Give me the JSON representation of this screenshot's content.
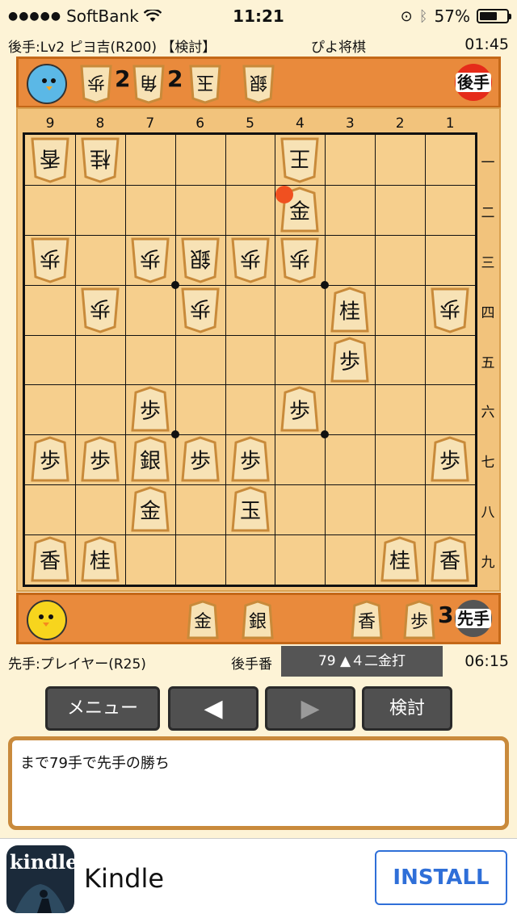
{
  "status": {
    "carrier": "SoftBank",
    "time": "11:21",
    "battery": "57%"
  },
  "gote_info": {
    "player": "後手:Lv2 ピヨ吉(R200) 【検討】",
    "app_title": "ぴよ将棋",
    "clock": "01:45"
  },
  "gote_hand": {
    "badge": "後手",
    "pieces": [
      {
        "kanji": "歩",
        "count": "2"
      },
      {
        "kanji": "角",
        "count": "2"
      },
      {
        "kanji": "玉",
        "count": ""
      },
      {
        "kanji": "銀",
        "count": ""
      }
    ]
  },
  "board": {
    "columns": [
      "9",
      "8",
      "7",
      "6",
      "5",
      "4",
      "3",
      "2",
      "1"
    ],
    "rows": [
      "一",
      "二",
      "三",
      "四",
      "五",
      "六",
      "七",
      "八",
      "九"
    ],
    "pieces": [
      {
        "file": 9,
        "rank": 1,
        "kanji": "香",
        "owner": "gote"
      },
      {
        "file": 8,
        "rank": 1,
        "kanji": "桂",
        "owner": "gote"
      },
      {
        "file": 4,
        "rank": 1,
        "kanji": "王",
        "owner": "gote"
      },
      {
        "file": 4,
        "rank": 2,
        "kanji": "金",
        "owner": "sente"
      },
      {
        "file": 9,
        "rank": 3,
        "kanji": "歩",
        "owner": "gote"
      },
      {
        "file": 7,
        "rank": 3,
        "kanji": "歩",
        "owner": "gote"
      },
      {
        "file": 6,
        "rank": 3,
        "kanji": "銀",
        "owner": "gote"
      },
      {
        "file": 5,
        "rank": 3,
        "kanji": "歩",
        "owner": "gote"
      },
      {
        "file": 4,
        "rank": 3,
        "kanji": "歩",
        "owner": "gote"
      },
      {
        "file": 8,
        "rank": 4,
        "kanji": "歩",
        "owner": "gote"
      },
      {
        "file": 6,
        "rank": 4,
        "kanji": "歩",
        "owner": "gote"
      },
      {
        "file": 3,
        "rank": 4,
        "kanji": "桂",
        "owner": "sente"
      },
      {
        "file": 1,
        "rank": 4,
        "kanji": "歩",
        "owner": "gote"
      },
      {
        "file": 3,
        "rank": 5,
        "kanji": "歩",
        "owner": "sente"
      },
      {
        "file": 7,
        "rank": 6,
        "kanji": "歩",
        "owner": "sente"
      },
      {
        "file": 4,
        "rank": 6,
        "kanji": "歩",
        "owner": "sente"
      },
      {
        "file": 9,
        "rank": 7,
        "kanji": "歩",
        "owner": "sente"
      },
      {
        "file": 8,
        "rank": 7,
        "kanji": "歩",
        "owner": "sente"
      },
      {
        "file": 7,
        "rank": 7,
        "kanji": "銀",
        "owner": "sente"
      },
      {
        "file": 6,
        "rank": 7,
        "kanji": "歩",
        "owner": "sente"
      },
      {
        "file": 5,
        "rank": 7,
        "kanji": "歩",
        "owner": "sente"
      },
      {
        "file": 1,
        "rank": 7,
        "kanji": "歩",
        "owner": "sente"
      },
      {
        "file": 7,
        "rank": 8,
        "kanji": "金",
        "owner": "sente"
      },
      {
        "file": 5,
        "rank": 8,
        "kanji": "玉",
        "owner": "sente"
      },
      {
        "file": 9,
        "rank": 9,
        "kanji": "香",
        "owner": "sente"
      },
      {
        "file": 8,
        "rank": 9,
        "kanji": "桂",
        "owner": "sente"
      },
      {
        "file": 2,
        "rank": 9,
        "kanji": "桂",
        "owner": "sente"
      },
      {
        "file": 1,
        "rank": 9,
        "kanji": "香",
        "owner": "sente"
      }
    ],
    "last_move": {
      "file": 4,
      "rank": 2
    }
  },
  "sente_hand": {
    "badge": "先手",
    "pieces": [
      {
        "kanji": "金",
        "count": ""
      },
      {
        "kanji": "銀",
        "count": ""
      },
      {
        "kanji": "香",
        "count": ""
      },
      {
        "kanji": "歩",
        "count": "3"
      }
    ]
  },
  "sente_info": {
    "player": "先手:プレイヤー(R25)",
    "turn": "後手番",
    "move": "79 ▲４二金打",
    "clock": "06:15"
  },
  "buttons": {
    "menu": "メニュー",
    "prev": "◀",
    "next": "▶",
    "review": "検討"
  },
  "message": "まで79手で先手の勝ち",
  "ad": {
    "title": "Kindle",
    "icon_text": "kindle",
    "install": "INSTALL"
  }
}
